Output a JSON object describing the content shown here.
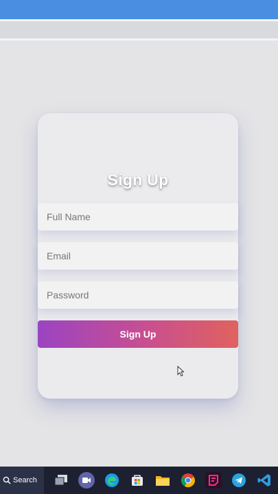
{
  "signup": {
    "title": "Sign Up",
    "full_name_placeholder": "Full Name",
    "email_placeholder": "Email",
    "password_placeholder": "Password",
    "submit_label": "Sign Up"
  },
  "taskbar": {
    "search_label": "Search",
    "apps": [
      "task-view",
      "teams-meet",
      "edge",
      "microsoft-store",
      "file-explorer",
      "chrome",
      "streaming-app",
      "telegram",
      "vscode"
    ]
  },
  "colors": {
    "gradient_start": "#9b44c2",
    "gradient_end": "#e0625e",
    "browser_bar": "#4a8ee2",
    "page_bg": "#e4e4e6",
    "taskbar_bg": "#1c2030"
  }
}
